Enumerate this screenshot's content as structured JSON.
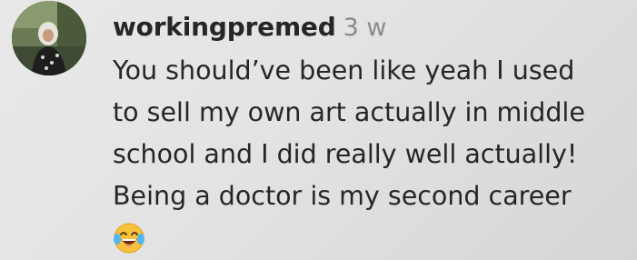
{
  "comment": {
    "username": "workingpremed",
    "timestamp": "3 w",
    "text_lines": [
      "You should’ve been like yeah I used",
      "to sell my own art actually in middle",
      "school and I did really well actually!",
      "Being a doctor is my second career"
    ],
    "emoji_icon": "face-with-tears-of-joy-icon"
  }
}
